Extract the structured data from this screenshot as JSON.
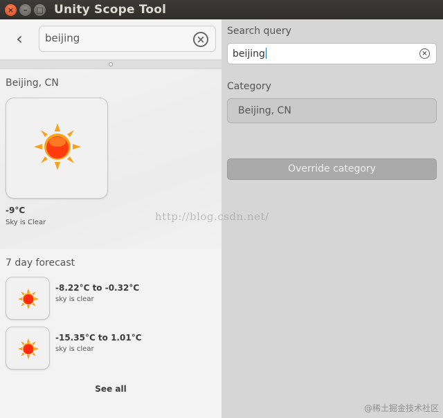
{
  "window": {
    "title": "Unity Scope Tool",
    "close_glyph": "×",
    "minimize_glyph": "–",
    "maximize_glyph": "□"
  },
  "scope": {
    "back_glyph": "‹",
    "search_value": "beijing",
    "clear_glyph": "×",
    "category_title": "Beijing, CN",
    "current": {
      "temperature": "-9°C",
      "description": "Sky is Clear",
      "icon": "sun-icon"
    },
    "forecast_title": "7 day forecast",
    "forecast": [
      {
        "range": "-8.22°C to -0.32°C",
        "description": "sky is clear",
        "icon": "sun-icon"
      },
      {
        "range": "-15.35°C to 1.01°C",
        "description": "sky is clear",
        "icon": "sun-icon"
      }
    ],
    "see_all_label": "See all"
  },
  "panel": {
    "search_query_label": "Search query",
    "search_query_value": "beijing",
    "clear_glyph": "×",
    "category_label": "Category",
    "category_value": "Beijing, CN",
    "override_button_label": "Override category"
  },
  "overlay": {
    "watermark_text": "http://blog.csdn.net/",
    "corner_text": "@稀土掘金技术社区"
  },
  "colors": {
    "titlebar": "#3c3b37",
    "close_button": "#e95420",
    "sun_core": "#ff3b10",
    "sun_rays": "#f7a21c"
  }
}
